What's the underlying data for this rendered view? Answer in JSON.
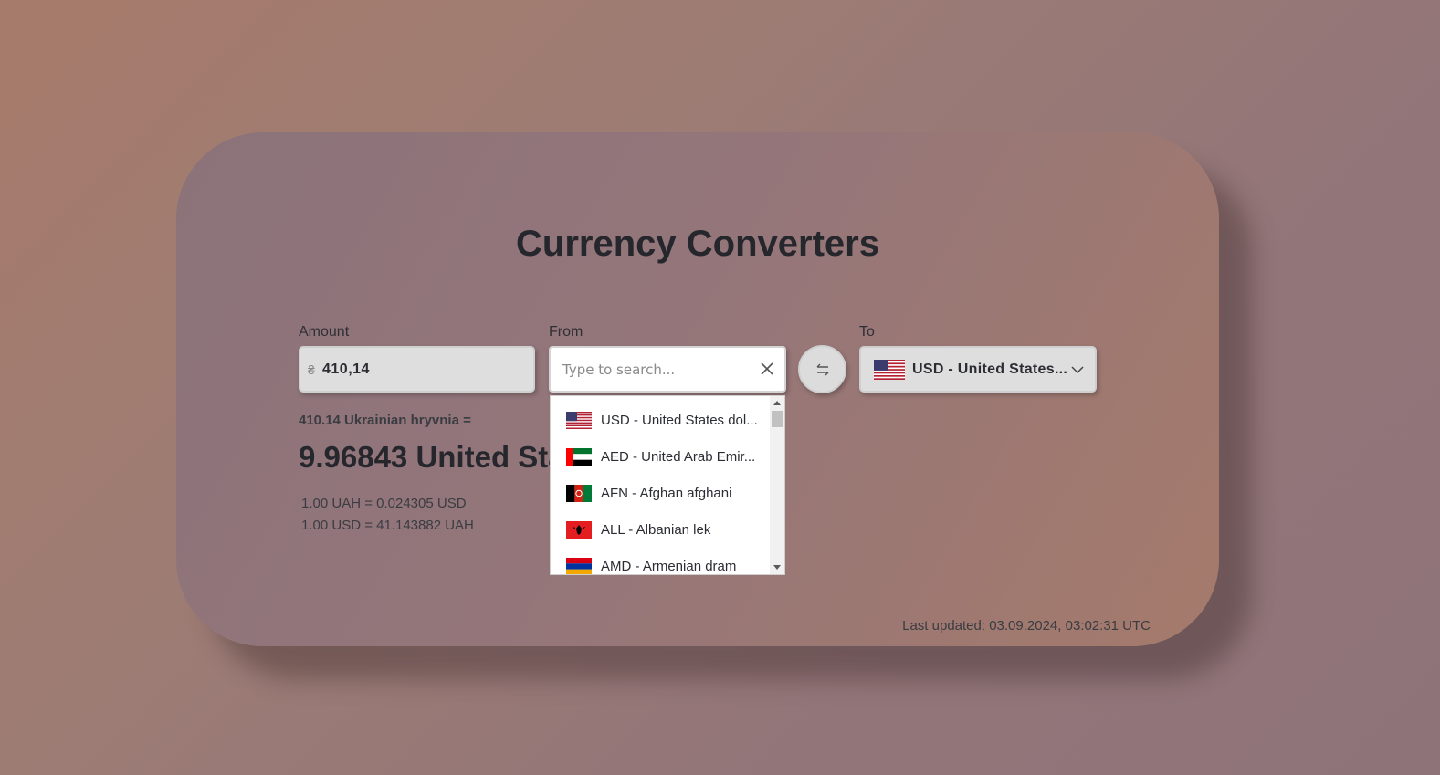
{
  "title": "Currency Converters",
  "amount": {
    "label": "Amount",
    "currency_sign": "₴",
    "value": "410,14"
  },
  "from": {
    "label": "From",
    "placeholder": "Type to search..."
  },
  "to": {
    "label": "To",
    "selected": "USD - United States..."
  },
  "result": {
    "caption": "410.14 Ukrainian hryvnia =",
    "main": "9.96843 United States dollars",
    "rate1": "1.00 UAH = 0.024305 USD",
    "rate2": "1.00 USD = 41.143882 UAH"
  },
  "last_updated": "Last updated: 03.09.2024, 03:02:31 UTC",
  "dropdown": {
    "items": [
      {
        "label": "USD - United States dol...",
        "flag": "us-flag-icon"
      },
      {
        "label": "AED - United Arab Emir...",
        "flag": "ae-flag-icon"
      },
      {
        "label": "AFN - Afghan afghani",
        "flag": "af-flag-icon"
      },
      {
        "label": "ALL - Albanian lek",
        "flag": "al-flag-icon"
      },
      {
        "label": "AMD - Armenian dram",
        "flag": "am-flag-icon"
      }
    ]
  },
  "colors": {
    "card_start": "#8b737a",
    "card_end": "#a57a6b",
    "text_dark": "#25272d",
    "input_bg": "#dedede"
  }
}
